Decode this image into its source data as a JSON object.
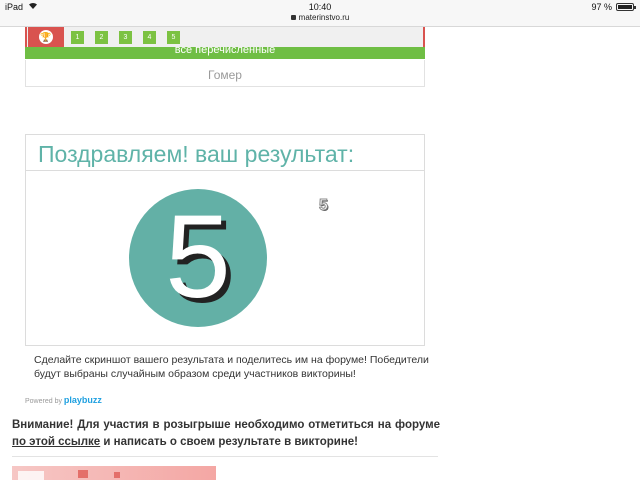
{
  "status_bar": {
    "device": "iPad",
    "time": "10:40",
    "url": "materinstvo.ru",
    "battery": "97 %",
    "battery_level": 0.97
  },
  "quiz_nav": {
    "numbers": [
      "1",
      "2",
      "3",
      "4",
      "5"
    ],
    "green_answer": "все перечисленные",
    "answer_option": "Гомер"
  },
  "result": {
    "heading": "Поздравляем! ваш результат:",
    "score": "5",
    "score_small": "5"
  },
  "share_text": "Сделайте скриншот вашего результата и поделитесь им на форуме! Победители будут выбраны случайным образом среди участников викторины!",
  "powered": {
    "prefix": "Powered by",
    "brand": "playbuzz"
  },
  "notice": {
    "text_before": "Внимание! Для участия в розыгрыше необходимо отметиться на форуме ",
    "link": "по этой ссылке",
    "text_after": " и написать о своем результате в викторине!"
  },
  "colors": {
    "accent_teal": "#63b0a6",
    "nav_red": "#d9534f",
    "nav_green": "#7cc242"
  }
}
